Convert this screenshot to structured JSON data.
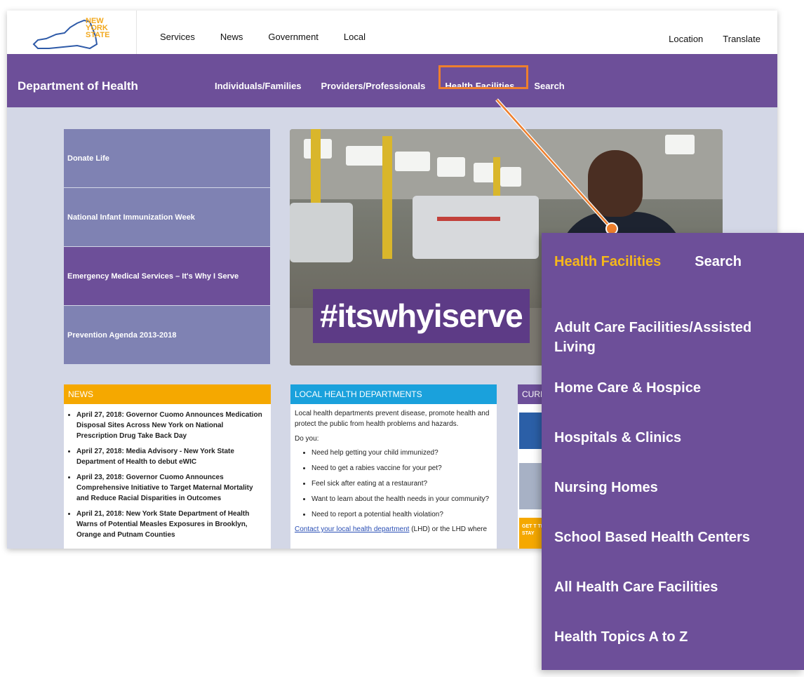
{
  "logo": {
    "line1": "NEW",
    "line2": "YORK",
    "line3": "STATE"
  },
  "top_nav": [
    "Services",
    "News",
    "Government",
    "Local"
  ],
  "top_right": [
    "Location",
    "Translate"
  ],
  "dept_title": "Department of Health",
  "sub_nav": [
    "Individuals/Families",
    "Providers/Professionals",
    "Health Facilities",
    "Search"
  ],
  "tiles": [
    "Donate Life",
    "National Infant Immunization Week",
    "Emergency Medical Services – It's Why I Serve",
    "Prevention Agenda 2013-2018"
  ],
  "hero": {
    "hashtag": "#itswhyiserve"
  },
  "news": {
    "header": "NEWS",
    "items": [
      "April 27, 2018: Governor Cuomo Announces Medication Disposal Sites Across New York on National Prescription Drug Take Back Day",
      "April 27, 2018: Media Advisory - New York State Department of Health to debut eWIC",
      "April 23, 2018: Governor Cuomo Announces Comprehensive Initiative to Target Maternal Mortality and Reduce Racial Disparities in Outcomes",
      "April 21, 2018: New York State Department of Health Warns of Potential Measles Exposures in Brooklyn, Orange and Putnam Counties"
    ]
  },
  "lhd": {
    "header": "LOCAL HEALTH DEPARTMENTS",
    "intro": "Local health departments prevent disease, promote health and protect the public from health problems and hazards.",
    "do_you": "Do you:",
    "items": [
      "Need help getting your child immunized?",
      "Need to get a rabies vaccine for your pet?",
      "Feel sick after eating at a restaurant?",
      "Want to learn about the health needs in your community?",
      "Need to report a potential health violation?"
    ],
    "cut_line_link": "Contact your local health department",
    "cut_line_rest": " (LHD) or the LHD where"
  },
  "current": {
    "header": "CURR",
    "promo": "GET T TREAT STAY"
  },
  "dropdown": {
    "tab_active": "Health Facilities",
    "tab_other": "Search",
    "items": [
      "Adult Care Facilities/Assisted Living",
      "Home Care & Hospice",
      "Hospitals & Clinics",
      "Nursing Homes",
      "School Based Health Centers",
      "All Health Care Facilities",
      "Health Topics A to Z"
    ]
  },
  "colors": {
    "purple": "#6d4f99",
    "accent_orange": "#ee7f2d",
    "highlight_yellow": "#f6b81a",
    "news_orange": "#f5a800",
    "lhd_blue": "#1aa1dc"
  }
}
